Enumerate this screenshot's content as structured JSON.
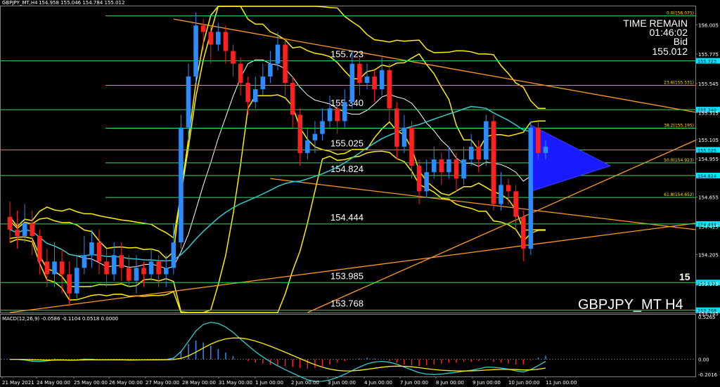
{
  "header": {
    "symbol_timeframe": "GBPJPY_MT,H4",
    "ohlc": "154.958 155.046 154.784 155.012"
  },
  "info_panel": {
    "time_remain_label": "TIME REMAIN",
    "time_remain_value": "01:46:02",
    "bid_label": "Bid",
    "bid_value": "155.012"
  },
  "watermark": "GBPJPY_MT H4",
  "partial_price_label": "15",
  "colors": {
    "background": "#000000",
    "bull_candle": "#2b8cff",
    "bear_candle": "#ff2020",
    "horizontal_levels": "#3cd85a",
    "fib_text": "#ffe400",
    "bollinger": "#ffee00",
    "trendline": "#ff9a1f",
    "moving_average": "#33cccc",
    "triangle": "#1a1aff",
    "axis_tag": "#00e5ff"
  },
  "chart_data": [
    {
      "type": "candlestick",
      "title": "GBPJPY_MT,H4",
      "ylim": [
        153.75,
        156.15
      ],
      "y_ticks": [
        "156.005",
        "155.775",
        "155.545",
        "155.315",
        "155.105",
        "154.955",
        "154.655",
        "154.425",
        "154.205",
        "153.975",
        "153.745"
      ],
      "x_ticks": [
        "21 May 2021",
        "24 May 00:00",
        "25 May 00:00",
        "26 May 00:00",
        "27 May 00:00",
        "28 May 00:00",
        "31 May 00:00",
        "1 Jun 00:00",
        "2 Jun 00:00",
        "3 Jun 00:00",
        "4 Jun 00:00",
        "7 Jun 00:00",
        "8 Jun 00:00",
        "9 Jun 00:00",
        "10 Jun 00:00",
        "11 Jun 00:00"
      ],
      "levels": [
        {
          "price": 155.723,
          "label": "155.723",
          "tag": "155.723"
        },
        {
          "price": 155.34,
          "label": "155.340",
          "tag": "155.340"
        },
        {
          "price": 155.025,
          "label": "155.025",
          "tag": "155.025"
        },
        {
          "price": 154.824,
          "label": "154.824",
          "tag": "154.824"
        },
        {
          "price": 154.444,
          "label": "154.444",
          "tag": "154.444"
        },
        {
          "price": 153.985,
          "label": "153.985",
          "tag": "153.985"
        },
        {
          "price": 153.768,
          "label": "153.768",
          "tag": "153.768"
        }
      ],
      "fibonacci": [
        {
          "price": 156.075,
          "label": "0.0(156.075)"
        },
        {
          "price": 155.531,
          "label": "23.6(155.531)"
        },
        {
          "price": 155.195,
          "label": "38.2(155.195)"
        },
        {
          "price": 154.923,
          "label": "50.0(154.923)"
        },
        {
          "price": 154.652,
          "label": "61.8(154.652)"
        }
      ],
      "candles": [
        [
          154.5,
          154.4,
          154.62,
          154.3
        ],
        [
          154.4,
          154.35,
          154.55,
          154.25
        ],
        [
          154.35,
          154.45,
          154.6,
          154.3
        ],
        [
          154.45,
          154.35,
          154.55,
          154.2
        ],
        [
          154.35,
          154.15,
          154.4,
          154.05
        ],
        [
          154.15,
          154.05,
          154.25,
          153.95
        ],
        [
          154.05,
          154.15,
          154.3,
          153.95
        ],
        [
          154.15,
          154.05,
          154.25,
          153.9
        ],
        [
          154.05,
          153.9,
          154.15,
          153.8
        ],
        [
          153.9,
          154.1,
          154.2,
          153.85
        ],
        [
          154.1,
          154.2,
          154.35,
          154.05
        ],
        [
          154.2,
          154.3,
          154.4,
          154.1
        ],
        [
          154.3,
          154.15,
          154.4,
          154.05
        ],
        [
          154.15,
          154.05,
          154.25,
          153.95
        ],
        [
          154.05,
          154.2,
          154.3,
          154.0
        ],
        [
          154.2,
          154.1,
          154.3,
          154.0
        ],
        [
          154.1,
          154.0,
          154.2,
          153.95
        ],
        [
          154.0,
          154.1,
          154.2,
          153.9
        ],
        [
          154.1,
          154.05,
          154.15,
          153.95
        ],
        [
          154.05,
          154.15,
          154.25,
          154.0
        ],
        [
          154.15,
          154.05,
          154.2,
          153.95
        ],
        [
          154.05,
          154.1,
          154.2,
          153.95
        ],
        [
          154.1,
          154.3,
          154.45,
          154.05
        ],
        [
          154.3,
          155.2,
          155.3,
          154.25
        ],
        [
          155.2,
          155.6,
          155.7,
          155.1
        ],
        [
          155.6,
          156.0,
          156.1,
          155.55
        ],
        [
          156.0,
          155.95,
          156.05,
          155.8
        ],
        [
          155.95,
          155.85,
          156.0,
          155.7
        ],
        [
          155.85,
          155.95,
          156.02,
          155.8
        ],
        [
          155.95,
          155.8,
          156.0,
          155.7
        ],
        [
          155.8,
          155.7,
          155.85,
          155.6
        ],
        [
          155.7,
          155.55,
          155.75,
          155.45
        ],
        [
          155.55,
          155.4,
          155.6,
          155.3
        ],
        [
          155.4,
          155.5,
          155.6,
          155.35
        ],
        [
          155.5,
          155.6,
          155.7,
          155.45
        ],
        [
          155.6,
          155.7,
          155.8,
          155.55
        ],
        [
          155.7,
          155.85,
          155.95,
          155.65
        ],
        [
          155.85,
          155.55,
          155.9,
          155.45
        ],
        [
          155.55,
          155.3,
          155.6,
          155.2
        ],
        [
          155.3,
          155.0,
          155.35,
          154.9
        ],
        [
          155.0,
          155.1,
          155.2,
          154.95
        ],
        [
          155.1,
          155.15,
          155.25,
          155.0
        ],
        [
          155.15,
          155.25,
          155.35,
          155.1
        ],
        [
          155.25,
          155.35,
          155.45,
          155.2
        ],
        [
          155.35,
          155.25,
          155.4,
          155.15
        ],
        [
          155.25,
          155.4,
          155.5,
          155.2
        ],
        [
          155.4,
          155.7,
          155.8,
          155.35
        ],
        [
          155.7,
          155.55,
          155.75,
          155.45
        ],
        [
          155.55,
          155.6,
          155.7,
          155.5
        ],
        [
          155.6,
          155.5,
          155.65,
          155.4
        ],
        [
          155.5,
          155.65,
          155.75,
          155.45
        ],
        [
          155.65,
          155.35,
          155.7,
          155.25
        ],
        [
          155.35,
          155.05,
          155.4,
          154.95
        ],
        [
          155.05,
          155.2,
          155.3,
          155.0
        ],
        [
          155.2,
          154.9,
          155.25,
          154.8
        ],
        [
          154.9,
          154.7,
          154.95,
          154.6
        ],
        [
          154.7,
          154.85,
          154.95,
          154.65
        ],
        [
          154.85,
          154.95,
          155.05,
          154.8
        ],
        [
          154.95,
          154.85,
          155.0,
          154.75
        ],
        [
          154.85,
          154.95,
          155.05,
          154.8
        ],
        [
          154.95,
          154.8,
          155.0,
          154.7
        ],
        [
          154.8,
          154.95,
          155.05,
          154.75
        ],
        [
          154.95,
          155.05,
          155.15,
          154.9
        ],
        [
          155.05,
          154.95,
          155.1,
          154.85
        ],
        [
          154.95,
          155.25,
          155.3,
          154.9
        ],
        [
          155.25,
          154.6,
          155.3,
          154.55
        ],
        [
          154.6,
          154.75,
          154.85,
          154.55
        ],
        [
          154.75,
          154.7,
          154.8,
          154.6
        ],
        [
          154.7,
          154.5,
          154.75,
          154.4
        ],
        [
          154.5,
          154.25,
          154.55,
          154.15
        ],
        [
          154.25,
          155.2,
          155.25,
          154.2
        ],
        [
          155.2,
          155.0,
          155.25,
          154.95
        ],
        [
          155.0,
          155.05,
          155.1,
          154.95
        ]
      ],
      "annotations": [
        "triangle pattern",
        "fibonacci retracement",
        "bollinger bands",
        "trendlines"
      ]
    },
    {
      "type": "histogram",
      "title": "MACD(12,26,9) -0.0586 -0.1104 0.0518 0.0000",
      "ylim": [
        -0.2016,
        0.5265
      ],
      "y_ticks": [
        "0.5265",
        "0.00",
        "-0.2016"
      ],
      "values": [
        0.0,
        0.0,
        -0.01,
        -0.02,
        -0.01,
        0.0,
        0.01,
        0.0,
        -0.01,
        0.0,
        0.01,
        0.0,
        -0.01,
        0.0,
        0.0,
        0.0,
        -0.01,
        0.0,
        0.0,
        0.0,
        0.0,
        0.0,
        0.02,
        0.1,
        0.18,
        0.22,
        0.2,
        0.16,
        0.12,
        0.08,
        0.04,
        0.0,
        -0.02,
        -0.04,
        -0.05,
        -0.06,
        -0.07,
        -0.08,
        -0.09,
        -0.1,
        -0.11,
        -0.1,
        -0.08,
        -0.06,
        -0.04,
        -0.02,
        0.0,
        0.01,
        0.02,
        0.01,
        0.0,
        -0.02,
        -0.04,
        -0.06,
        -0.07,
        -0.08,
        -0.07,
        -0.06,
        -0.05,
        -0.04,
        -0.04,
        -0.03,
        -0.03,
        -0.02,
        -0.01,
        -0.03,
        -0.04,
        -0.05,
        -0.06,
        -0.06,
        -0.01,
        0.02,
        0.04
      ]
    }
  ]
}
